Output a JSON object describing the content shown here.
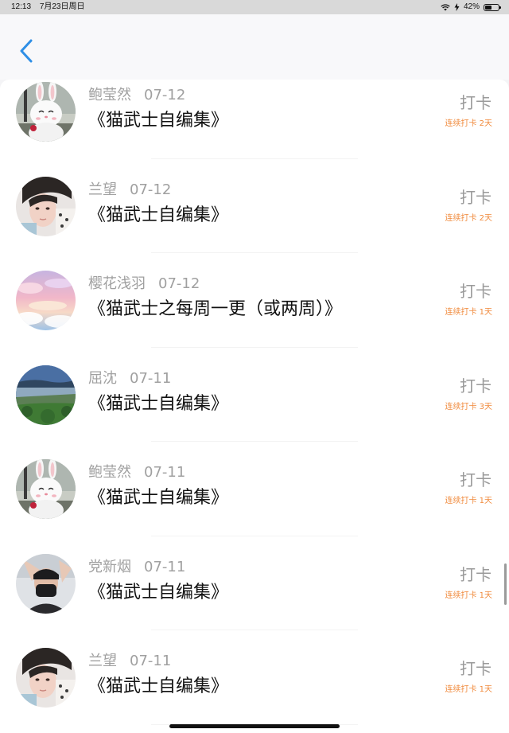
{
  "status_bar": {
    "time": "12:13",
    "date": "7月23日周日",
    "battery": "42%",
    "battery_level": 0.42
  },
  "header": {
    "back_icon": "chevron-left-icon",
    "accent_color": "#2f8fe6"
  },
  "colors": {
    "streak": "#f08a3c",
    "username": "#a0a0a0",
    "checkin": "#9a9a9a"
  },
  "entries": [
    {
      "user": "鲍莹然",
      "date": "07-12",
      "title": "《猫武士自编集》",
      "action": "打卡",
      "streak": "连续打卡 2天",
      "avatar": "bunny-doll-avatar"
    },
    {
      "user": "兰望",
      "date": "07-12",
      "title": "《猫武士自编集》",
      "action": "打卡",
      "streak": "连续打卡 2天",
      "avatar": "boy-portrait-avatar"
    },
    {
      "user": "樱花浅羽",
      "date": "07-12",
      "title": "《猫武士之每周一更（或两周）》",
      "action": "打卡",
      "streak": "连续打卡 1天",
      "avatar": "pastel-sky-avatar"
    },
    {
      "user": "屈沈",
      "date": "07-11",
      "title": "《猫武士自编集》",
      "action": "打卡",
      "streak": "连续打卡 3天",
      "avatar": "landscape-avatar"
    },
    {
      "user": "鲍莹然",
      "date": "07-11",
      "title": "《猫武士自编集》",
      "action": "打卡",
      "streak": "连续打卡 1天",
      "avatar": "bunny-doll-avatar"
    },
    {
      "user": "党新烟",
      "date": "07-11",
      "title": "《猫武士自编集》",
      "action": "打卡",
      "streak": "连续打卡 1天",
      "avatar": "masked-person-avatar"
    },
    {
      "user": "兰望",
      "date": "07-11",
      "title": "《猫武士自编集》",
      "action": "打卡",
      "streak": "连续打卡 1天",
      "avatar": "boy-portrait-avatar"
    }
  ]
}
